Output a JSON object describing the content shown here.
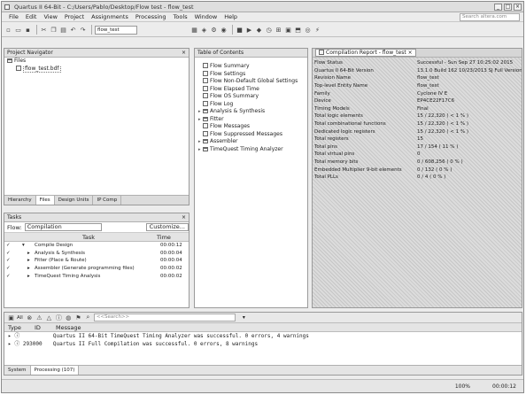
{
  "title": {
    "text": "Quartus II 64-Bit - C:/Users/Pablo/Desktop/Flow test - flow_test",
    "min": "_",
    "max": "□",
    "close": "×"
  },
  "menu": {
    "items": [
      "File",
      "Edit",
      "View",
      "Project",
      "Assignments",
      "Processing",
      "Tools",
      "Window",
      "Help"
    ],
    "search_placeholder": "Search altera.com"
  },
  "toolbar": {
    "entity": "flow_test"
  },
  "navigator": {
    "title": "Project Navigator",
    "root": "Files",
    "file": "flow_test.bdf",
    "tabs": [
      "Hierarchy",
      "Files",
      "Design Units",
      "IP Comp"
    ]
  },
  "tasks": {
    "title": "Tasks",
    "flow_label": "Flow:",
    "flow_value": "Compilation",
    "customize": "Customize...",
    "col_task": "Task",
    "col_time": "Time",
    "rows": [
      {
        "check": "✓",
        "exp": "▾",
        "label": "Compile Design",
        "time": "00:00:12"
      },
      {
        "check": "✓",
        "exp": "▸",
        "label": "Analysis & Synthesis",
        "time": "00:00:04"
      },
      {
        "check": "✓",
        "exp": "▸",
        "label": "Fitter (Place & Route)",
        "time": "00:00:04"
      },
      {
        "check": "✓",
        "exp": "▸",
        "label": "Assembler (Generate programming files)",
        "time": "00:00:02"
      },
      {
        "check": "✓",
        "exp": "▸",
        "label": "TimeQuest Timing Analysis",
        "time": "00:00:02"
      }
    ]
  },
  "report_toc": {
    "title": "Table of Contents",
    "items": [
      {
        "exp": "",
        "label": "Flow Summary"
      },
      {
        "exp": "",
        "label": "Flow Settings"
      },
      {
        "exp": "",
        "label": "Flow Non-Default Global Settings"
      },
      {
        "exp": "",
        "label": "Flow Elapsed Time"
      },
      {
        "exp": "",
        "label": "Flow OS Summary"
      },
      {
        "exp": "",
        "label": "Flow Log"
      },
      {
        "exp": "▸",
        "label": "Analysis & Synthesis"
      },
      {
        "exp": "▸",
        "label": "Fitter"
      },
      {
        "exp": "",
        "label": "Flow Messages"
      },
      {
        "exp": "",
        "label": "Flow Suppressed Messages"
      },
      {
        "exp": "▸",
        "label": "Assembler"
      },
      {
        "exp": "▸",
        "label": "TimeQuest Timing Analyzer"
      }
    ]
  },
  "report": {
    "tab_label": "Compilation Report - flow_test",
    "rows": [
      [
        "Flow Status",
        "Successful - Sun Sep 27 10:25:02 2015"
      ],
      [
        "Quartus II 64-Bit Version",
        "13.1.0 Build 162 10/23/2013 SJ Full Version"
      ],
      [
        "Revision Name",
        "flow_test"
      ],
      [
        "Top-level Entity Name",
        "flow_test"
      ],
      [
        "Family",
        "Cyclone IV E"
      ],
      [
        "Device",
        "EP4CE22F17C6"
      ],
      [
        "Timing Models",
        "Final"
      ],
      [
        "Total logic elements",
        "15 / 22,320 ( < 1 % )"
      ],
      [
        "    Total combinational functions",
        "15 / 22,320 ( < 1 % )"
      ],
      [
        "    Dedicated logic registers",
        "15 / 22,320 ( < 1 % )"
      ],
      [
        "Total registers",
        "15"
      ],
      [
        "Total pins",
        "17 / 154 ( 11 % )"
      ],
      [
        "Total virtual pins",
        "0"
      ],
      [
        "Total memory bits",
        "0 / 608,256 ( 0 % )"
      ],
      [
        "Embedded Multiplier 9-bit elements",
        "0 / 132 ( 0 % )"
      ],
      [
        "Total PLLs",
        "0 / 4 ( 0 % )"
      ]
    ]
  },
  "messages": {
    "filter_label": "All",
    "search_placeholder": "<<Search>>",
    "col_type": "Type",
    "col_id": "ID",
    "col_message": "Message",
    "rows": [
      {
        "id": "",
        "text": "Quartus II 64-Bit TimeQuest Timing Analyzer was successful. 0 errors, 4 warnings"
      },
      {
        "id": "293000",
        "text": "Quartus II Full Compilation was successful. 0 errors, 8 warnings"
      }
    ],
    "tabs": [
      "System",
      "Processing (107)"
    ]
  },
  "status": {
    "zoom": "100%",
    "time": "00:00:12"
  }
}
